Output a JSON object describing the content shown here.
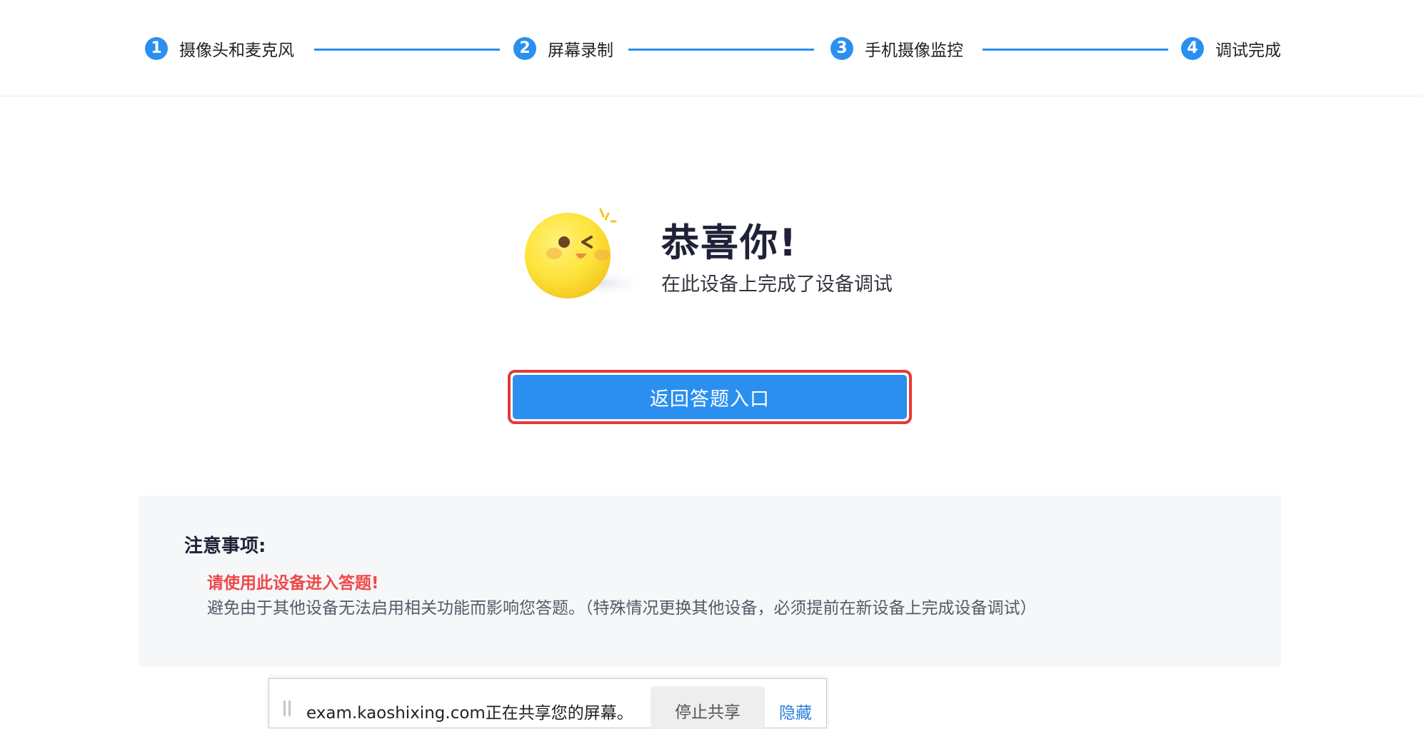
{
  "stepper": {
    "steps": [
      {
        "number": "1",
        "label": "摄像头和麦克风"
      },
      {
        "number": "2",
        "label": "屏幕录制"
      },
      {
        "number": "3",
        "label": "手机摄像监控"
      },
      {
        "number": "4",
        "label": "调试完成"
      }
    ],
    "accent_color": "#2b8ff0"
  },
  "success": {
    "icon": "winking-face-emoji-icon",
    "title": "恭喜你!",
    "subtitle": "在此设备上完成了设备调试"
  },
  "actions": {
    "return_label": "返回答题入口"
  },
  "notice": {
    "title": "注意事项:",
    "warning": "请使用此设备进入答题!",
    "description": "避免由于其他设备无法启用相关功能而影响您答题。（特殊情况更换其他设备，必须提前在新设备上完成设备调试）",
    "warning_color": "#f0484a"
  },
  "share_bar": {
    "handle_icon": "drag-handle-icon",
    "message": "exam.kaoshixing.com正在共享您的屏幕。",
    "stop_label": "停止共享",
    "hide_label": "隐藏"
  }
}
